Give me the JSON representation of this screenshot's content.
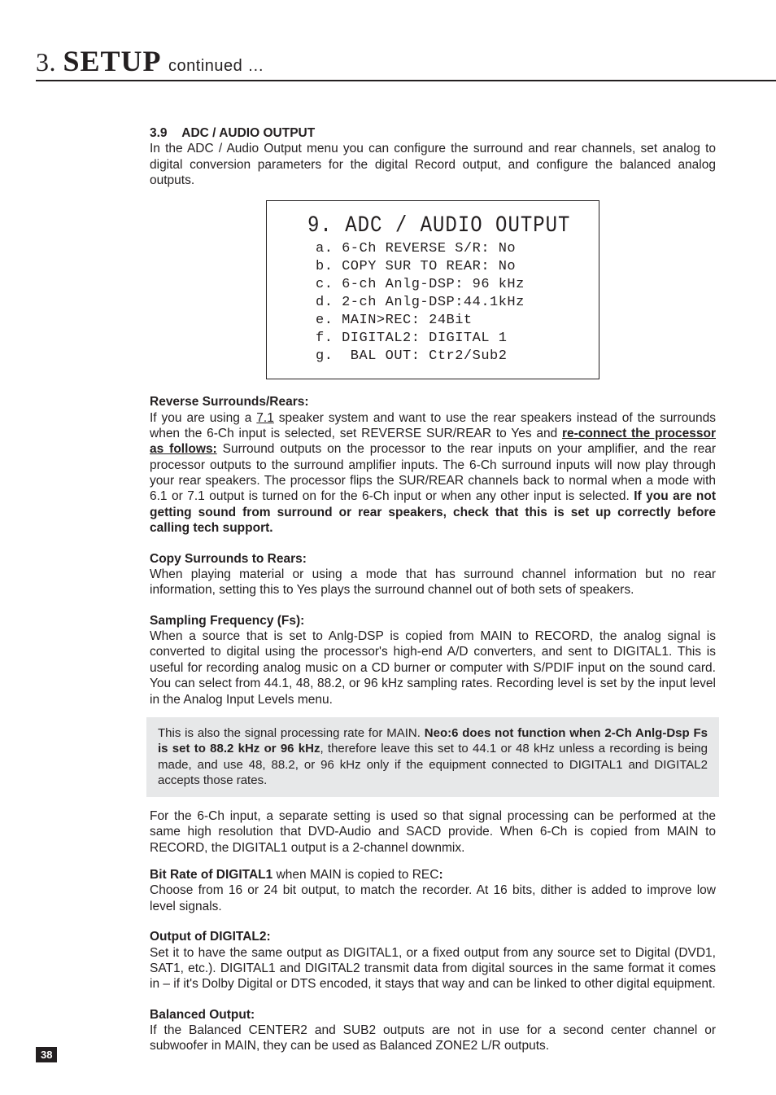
{
  "header": {
    "section_number": "3.",
    "section_word": "SETUP",
    "continued": "continued …"
  },
  "section": {
    "number": "3.9",
    "title": "ADC / AUDIO OUTPUT",
    "intro": "In the ADC / Audio Output menu you can configure the surround and rear channels, set analog to digital conversion parameters for the digital Record output, and configure the balanced analog outputs."
  },
  "menu": {
    "title": "9. ADC / AUDIO OUTPUT",
    "rows": [
      "a. 6-Ch REVERSE S/R: No",
      "b. COPY SUR TO REAR: No",
      "c. 6-ch Anlg-DSP: 96 kHz",
      "d. 2-ch Anlg-DSP:44.1kHz",
      "e. MAIN>REC: 24Bit",
      "f. DIGITAL2: DIGITAL 1",
      "g.  BAL OUT: Ctr2/Sub2"
    ]
  },
  "reverse": {
    "heading": "Reverse Surrounds/Rears:",
    "t1a": "If you are using a ",
    "t1b": "7.1",
    "t1c": " speaker system and want to use the rear speakers instead of the surrounds when the 6-Ch input is selected, set REVERSE SUR/REAR to Yes and ",
    "t1d": "re-connect the processor as follows:",
    "t1e": " Surround outputs on the processor to the rear inputs on your amplifier, and the rear processor outputs to the surround amplifier inputs. The 6-Ch surround inputs will now play through your rear speakers. The processor flips the SUR/REAR channels back to normal when a mode with 6.1 or 7.1 output is turned on for the 6-Ch input or when any other input is selected. ",
    "t1f": "If you are not getting sound from surround or rear speakers, check that this is set up correctly before calling tech support."
  },
  "copy": {
    "heading": "Copy Surrounds to Rears:",
    "body": "When playing material or using a mode that has surround channel information but no rear information, setting this to Yes plays the surround channel out of both sets of speakers."
  },
  "fs": {
    "heading": "Sampling Frequency (Fs):",
    "body": "When a source that is set to Anlg-DSP is copied from MAIN to RECORD, the analog signal is converted to digital using the processor's high-end A/D converters, and sent to DIGITAL1. This is useful for recording analog music on a CD burner or computer with S/PDIF input on the sound card. You can select from 44.1, 48, 88.2, or 96 kHz sampling rates. Recording level is set by the input level in the Analog Input Levels menu."
  },
  "note": {
    "t1": "This is also the signal processing rate for MAIN. ",
    "t2": "Neo:6 does not function when 2-Ch Anlg-Dsp Fs is set to 88.2 kHz or 96 kHz",
    "t3": ", therefore leave this set to 44.1 or 48 kHz unless a recording is being made, and use 48, 88.2, or 96 kHz only if the equipment connected to DIGITAL1 and DIGITAL2 accepts those rates."
  },
  "fs_after": "For the 6-Ch input, a separate setting is used so that signal processing can be performed at the same high resolution that DVD-Audio and SACD provide. When 6-Ch is copied from MAIN to RECORD, the DIGITAL1 output is a 2-channel downmix.",
  "bitrate": {
    "heading": "Bit Rate of DIGITAL1",
    "heading_after": " when MAIN is copied to REC",
    "colon": ":",
    "body": "Choose from 16 or 24 bit output, to match the recorder. At 16 bits, dither is added to improve low level signals."
  },
  "dig2": {
    "heading": "Output of DIGITAL2:",
    "body": "Set it to have the same output as DIGITAL1, or a fixed output from any source set to Digital (DVD1, SAT1, etc.). DIGITAL1 and DIGITAL2 transmit data from digital sources in the same format it comes in – if it's Dolby Digital or DTS encoded, it stays that way and can be linked to other digital equipment."
  },
  "bal": {
    "heading": "Balanced Output:",
    "body": "If the Balanced CENTER2 and SUB2 outputs are not in use for a second center channel or subwoofer in MAIN, they can be used as Balanced ZONE2 L/R outputs."
  },
  "page_number": "38"
}
